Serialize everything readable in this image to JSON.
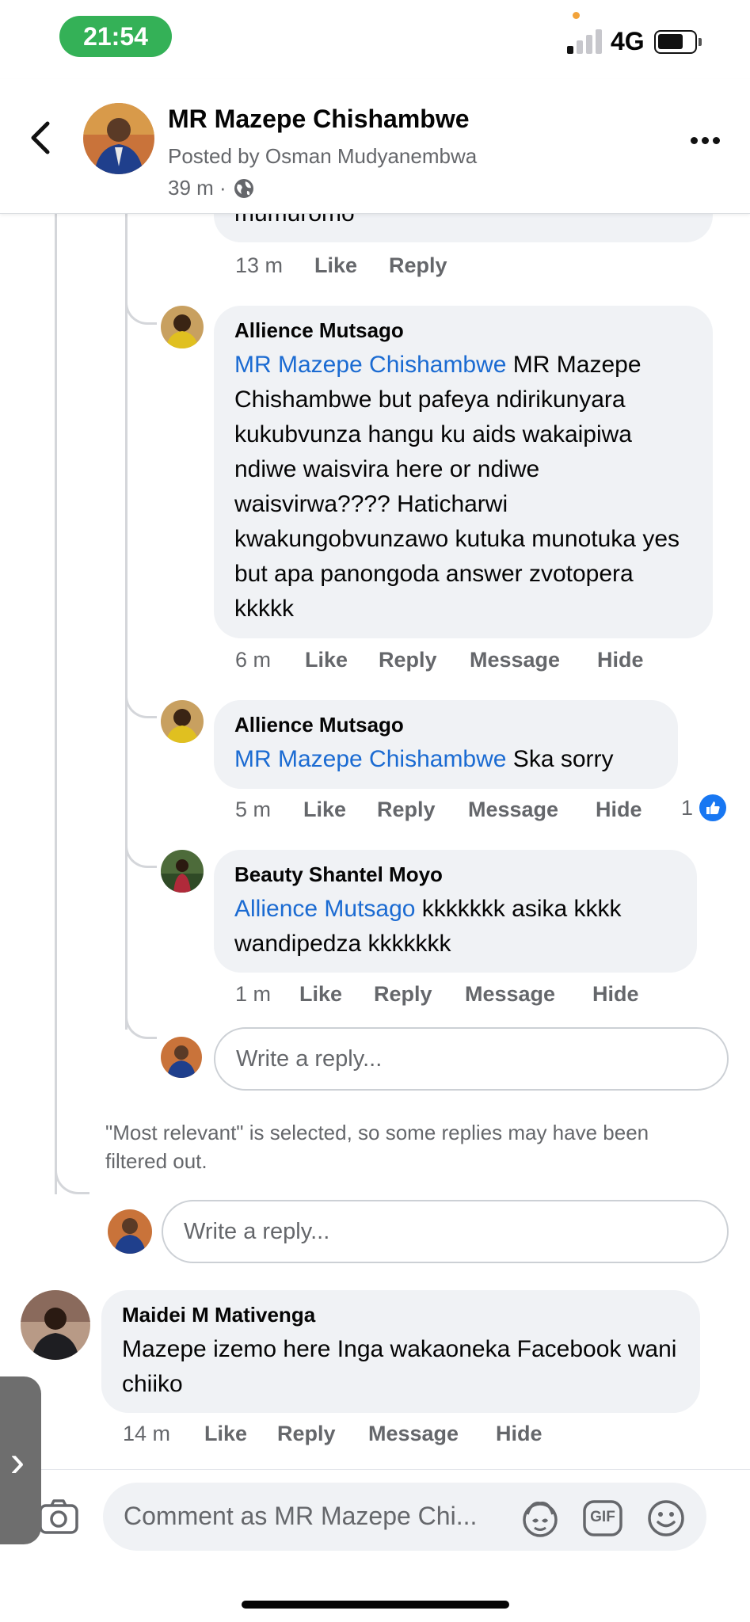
{
  "status_bar": {
    "time": "21:54",
    "network": "4G",
    "colors": {
      "time_pill": "#34b157",
      "dot": "#f2a33a"
    }
  },
  "header": {
    "title": "MR Mazepe Chishambwe",
    "posted_by": "Posted by Osman Mudyanembwa",
    "time": "39 m ·",
    "icons": {
      "back": "chevron-left-icon",
      "privacy": "globe-icon",
      "more": "more-dots-icon"
    }
  },
  "actions_labels": {
    "like": "Like",
    "reply": "Reply",
    "message": "Message",
    "hide": "Hide"
  },
  "top_partial": {
    "text": "mumuromo",
    "time": "13 m"
  },
  "replies": [
    {
      "name": "Allience Mutsago",
      "mention": "MR Mazepe Chishambwe",
      "text": " MR Mazepe Chishambwe but pafeya ndirikunyara kukubvunza hangu ku aids wakaipiwa ndiwe waisvira here or ndiwe waisvirwa???? Haticharwi kwakungobvunzawo kutuka munotuka yes but apa panongoda answer zvotopera kkkkk",
      "time": "6 m"
    },
    {
      "name": "Allience Mutsago",
      "mention": "MR Mazepe Chishambwe",
      "text": " Ska sorry",
      "time": "5 m",
      "like_count": "1"
    },
    {
      "name": "Beauty Shantel Moyo",
      "mention": "Allience Mutsago",
      "text": " kkkkkkk asika kkkk wandipedza kkkkkkk",
      "time": "1 m"
    }
  ],
  "reply_placeholder": "Write a reply...",
  "filtered_note": "\"Most relevant\" is selected, so some replies may have been filtered out.",
  "outer_reply_placeholder": "Write a reply...",
  "top_comment": {
    "name": "Maidei M Mativenga",
    "text": "Mazepe izemo here Inga wakaoneka Facebook wani chiiko",
    "time": "14 m"
  },
  "composer": {
    "placeholder": "Comment as MR Mazepe Chi...",
    "gif_label": "GIF",
    "icons": {
      "camera": "camera-icon",
      "avatar_sticker": "avatar-sticker-icon",
      "gif": "gif-icon",
      "emoji": "emoji-icon"
    }
  },
  "side_tab": {
    "label": "›"
  },
  "colors": {
    "link": "#1b6bd2",
    "bubble": "#f0f2f5",
    "like_blue": "#1877f2",
    "secondary_text": "#65676b"
  }
}
